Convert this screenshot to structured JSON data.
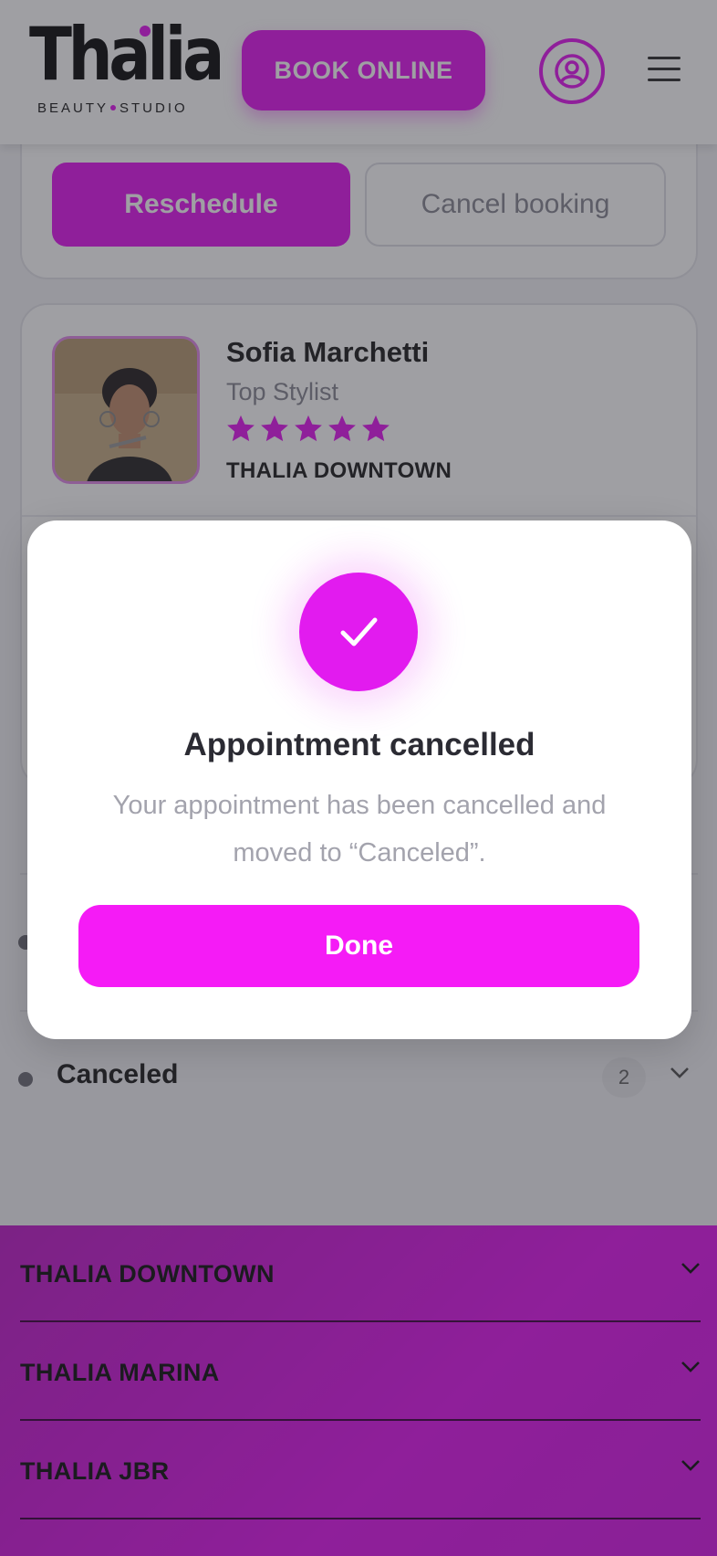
{
  "header": {
    "logo_text": "Thalia",
    "logo_sub_left": "BEAUTY",
    "logo_sub_right": "STUDIO",
    "book_online_label": "BOOK ONLINE"
  },
  "booking_actions": {
    "reschedule_label": "Reschedule",
    "cancel_label": "Cancel booking"
  },
  "stylist": {
    "name": "Sofia Marchetti",
    "title": "Top Stylist",
    "rating": 5,
    "location": "THALIA DOWNTOWN"
  },
  "sections": {
    "canceled_label": "Canceled",
    "canceled_count": "2"
  },
  "footer": {
    "locations": [
      "THALIA DOWNTOWN",
      "THALIA MARINA",
      "THALIA JBR"
    ]
  },
  "modal": {
    "title": "Appointment cancelled",
    "message": "Your appointment has been cancelled and moved to “Canceled”.",
    "done_label": "Done"
  },
  "colors": {
    "accent": "#e21bef",
    "done_button": "#f51bf6"
  }
}
